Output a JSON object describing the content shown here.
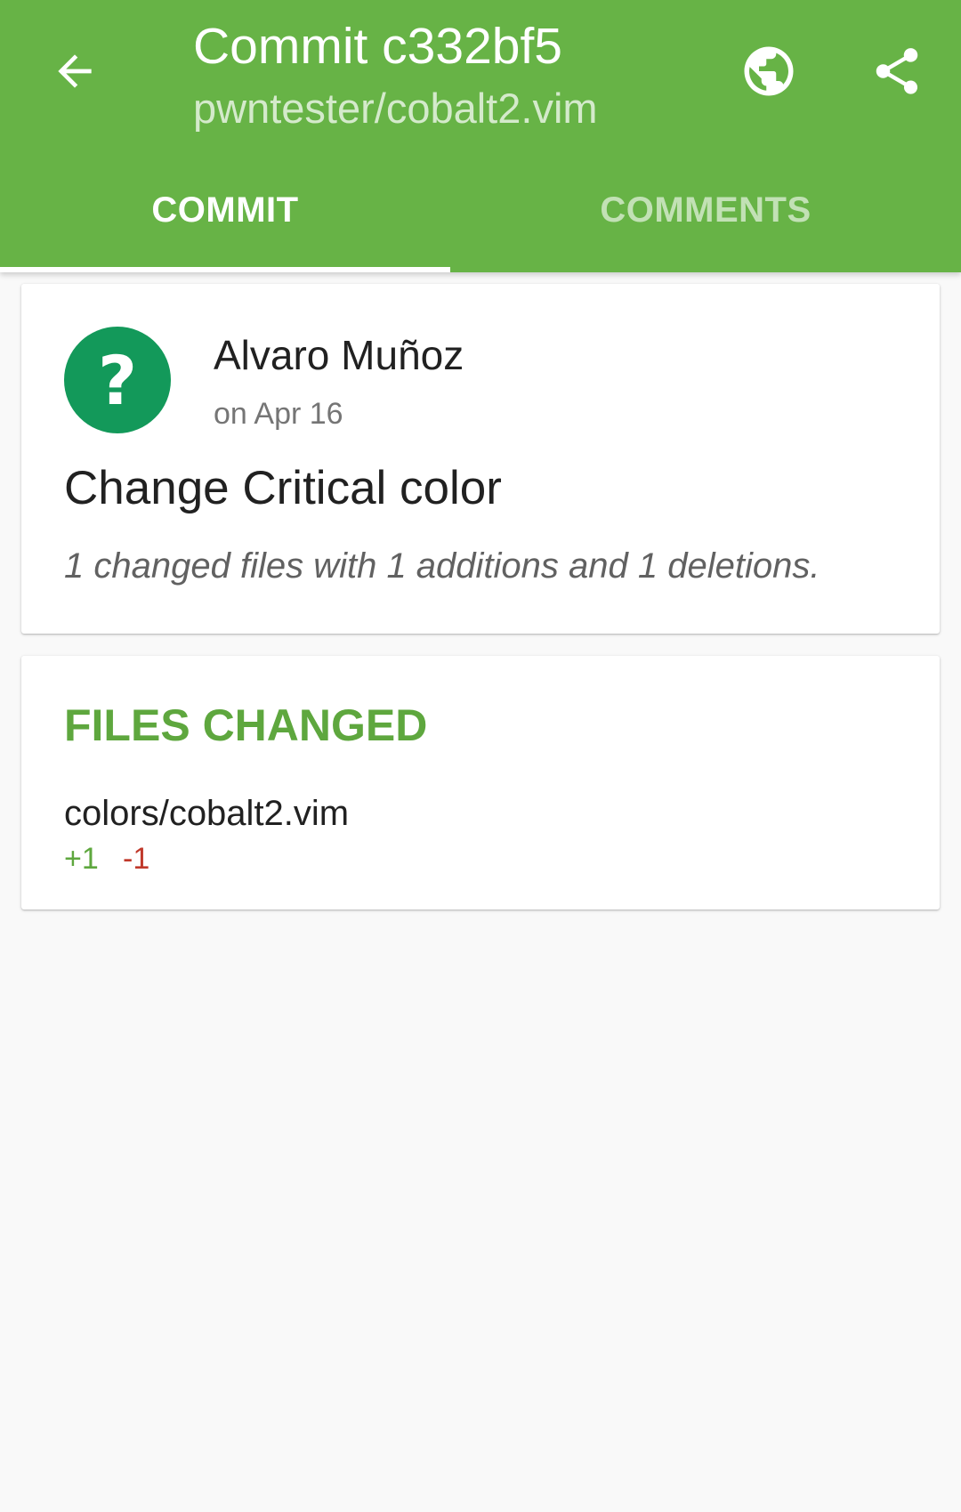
{
  "colors": {
    "appbar": "#67b346",
    "accent": "#5ea73e",
    "avatar": "#13995a",
    "deletion": "#c0392b"
  },
  "toolbar": {
    "back_icon": "arrow-back-icon",
    "title": "Commit c332bf5",
    "subtitle": "pwntester/cobalt2.vim",
    "actions": [
      {
        "icon": "globe-icon"
      },
      {
        "icon": "share-icon"
      }
    ]
  },
  "tabs": [
    {
      "label": "COMMIT",
      "selected": true
    },
    {
      "label": "COMMENTS",
      "selected": false
    }
  ],
  "commit": {
    "avatar_glyph": "?",
    "author": "Alvaro Muñoz",
    "date": "on Apr 16",
    "message": "Change Critical color",
    "summary": "1 changed files with 1 additions and 1 deletions."
  },
  "files": {
    "heading": "FILES CHANGED",
    "items": [
      {
        "name": "colors/cobalt2.vim",
        "additions": "+1",
        "deletions": "-1"
      }
    ]
  }
}
